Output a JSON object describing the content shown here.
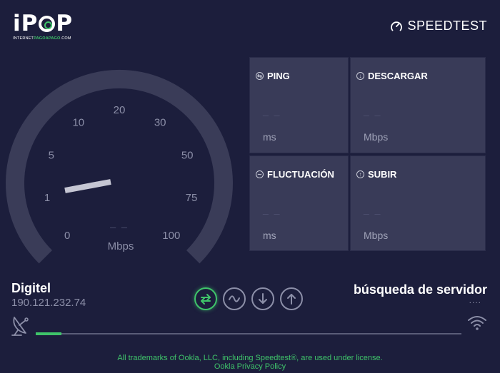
{
  "logo": {
    "main_left": "iP",
    "main_right": "P",
    "sub_prefix": "INTERNET",
    "sub_highlight": "PAGOAPAGO",
    "sub_suffix": ".COM"
  },
  "brand": {
    "name": "SPEEDTEST",
    "icon": "speedometer-icon"
  },
  "gauge": {
    "labels": [
      "0",
      "1",
      "5",
      "10",
      "20",
      "30",
      "50",
      "75",
      "100"
    ],
    "unit": "Mbps",
    "value_placeholder": "_ _"
  },
  "metrics": [
    {
      "id": "ping",
      "label": "PING",
      "icon": "ping-icon",
      "value": "_ _",
      "unit": "ms"
    },
    {
      "id": "download",
      "label": "DESCARGAR",
      "icon": "download-icon",
      "value": "_ _",
      "unit": "Mbps"
    },
    {
      "id": "jitter",
      "label": "FLUCTUACIÓN",
      "icon": "jitter-icon",
      "value": "_ _",
      "unit": "ms"
    },
    {
      "id": "upload",
      "label": "SUBIR",
      "icon": "upload-icon",
      "value": "_ _",
      "unit": "Mbps"
    }
  ],
  "connection": {
    "isp": "Digitel",
    "ip": "190.121.232.74"
  },
  "server": {
    "status": "búsqueda de servidor",
    "dots": "...."
  },
  "progress": {
    "fraction": 0.06
  },
  "footer": {
    "trademark": "All trademarks of Ookla, LLC, including Speedtest®, are used under license.",
    "privacy": "Ookla Privacy Policy"
  },
  "colors": {
    "background": "#1c1e3c",
    "card": "#393b58",
    "accent": "#3fc46a",
    "muted": "#8c8fa8"
  }
}
